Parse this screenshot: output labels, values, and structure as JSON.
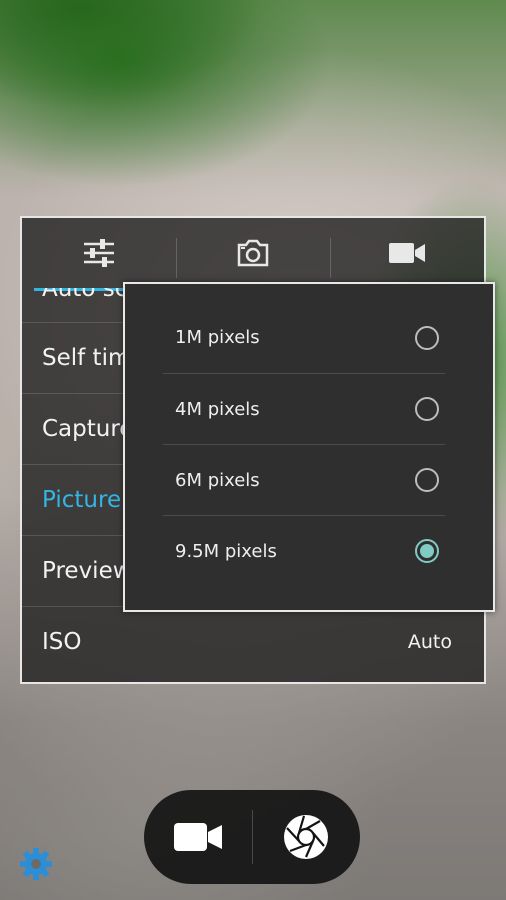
{
  "settings": {
    "partial_row_label": "Auto sc",
    "rows": [
      {
        "label": "Self tim",
        "value": ""
      },
      {
        "label": "Capture",
        "value": ""
      },
      {
        "label": "Picture",
        "value": ""
      },
      {
        "label": "Preview",
        "value": ""
      },
      {
        "label": "ISO",
        "value": "Auto"
      }
    ]
  },
  "picture_size_popup": {
    "options": [
      {
        "label": "1M pixels",
        "selected": false
      },
      {
        "label": "4M pixels",
        "selected": false
      },
      {
        "label": "6M pixels",
        "selected": false
      },
      {
        "label": "9.5M pixels",
        "selected": true
      }
    ]
  },
  "icons": {
    "tab1": "sliders-icon",
    "tab2": "camera-icon",
    "tab3": "video-camera-icon",
    "video_button": "video-camera-icon",
    "shutter_button": "aperture-icon",
    "settings": "gear-icon"
  },
  "colors": {
    "accent": "#33b5e5",
    "radio_selected": "#80cbc4",
    "settings_icon": "#2a8fd6"
  }
}
